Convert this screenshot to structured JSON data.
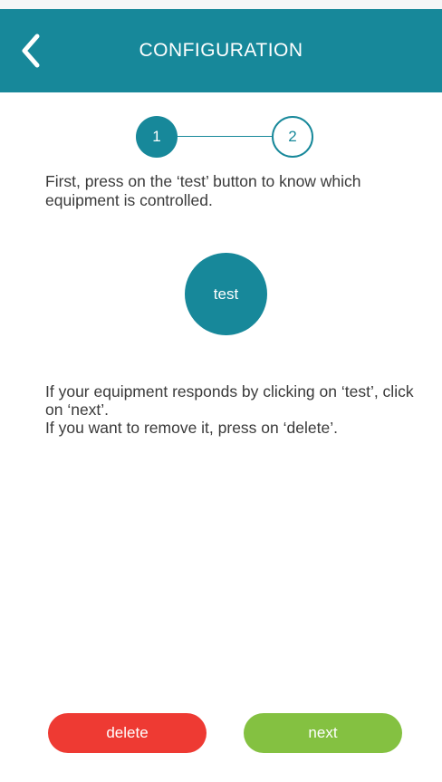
{
  "header": {
    "title": "CONFIGURATION",
    "back_icon": "chevron-left-icon"
  },
  "stepper": {
    "steps": [
      {
        "label": "1",
        "state": "active"
      },
      {
        "label": "2",
        "state": "inactive"
      }
    ]
  },
  "instruction": "First, press on the ‘test’ button to know which equipment is controlled.",
  "test_button_label": "test",
  "info": {
    "line1": "If your equipment responds by clicking on ‘test’, click on ‘next’.",
    "line2": "If you want to remove it, press on ‘delete’."
  },
  "actions": {
    "delete_label": "delete",
    "next_label": "next"
  },
  "colors": {
    "primary": "#17889a",
    "delete": "#ee3a33",
    "next": "#84c141",
    "text": "#3a3a3a"
  }
}
